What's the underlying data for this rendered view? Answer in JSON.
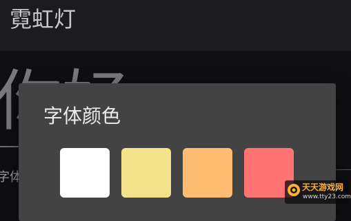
{
  "app": {
    "title": "霓虹灯"
  },
  "background": {
    "preview_text": "你好",
    "setting_label": "字体"
  },
  "dialog": {
    "title": "字体颜色",
    "swatches": [
      {
        "name": "white",
        "color": "#ffffff"
      },
      {
        "name": "yellow",
        "color": "#f4e28a"
      },
      {
        "name": "orange",
        "color": "#fdbc72"
      },
      {
        "name": "red",
        "color": "#ff7373"
      }
    ]
  },
  "watermark": {
    "name": "天天游戏网",
    "url": "www.tty23.com"
  },
  "colors": {
    "appbar": "#1c1b1f",
    "page": "#0f0e12",
    "dialog": "#434343",
    "watermark_accent": "#ffb03a"
  }
}
